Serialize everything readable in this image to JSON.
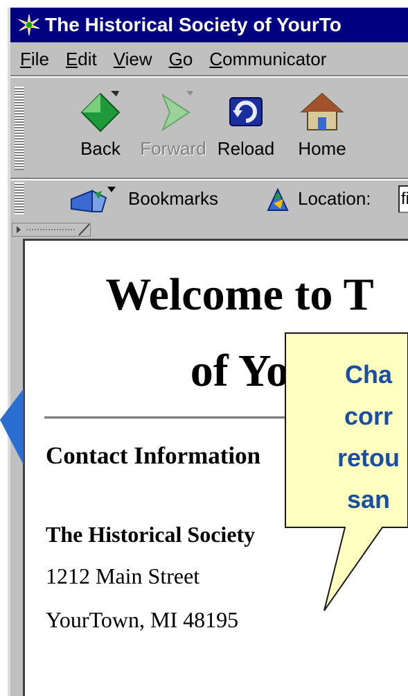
{
  "window": {
    "title": "The Historical Society of YourTo",
    "menu": [
      "File",
      "Edit",
      "View",
      "Go",
      "Communicator"
    ],
    "menu_mnemonics": [
      "F",
      "E",
      "V",
      "G",
      "C"
    ]
  },
  "navigation": {
    "back_label": "Back",
    "forward_label": "Forward",
    "reload_label": "Reload",
    "home_label": "Home"
  },
  "location_bar": {
    "bookmarks_label": "Bookmarks",
    "location_label": "Location:",
    "url_value": "file"
  },
  "page": {
    "heading_line1": "Welcome to T",
    "heading_line2": "of Yo",
    "contact_heading": "Contact Information",
    "org_name": "The Historical Society",
    "address_line1": "1212 Main Street",
    "address_line2": "YourTown, MI 48195"
  },
  "callout": {
    "lines": [
      "Cha",
      "corr",
      "retou",
      "san"
    ],
    "fill_color": "#ffffc0",
    "text_color": "#1a4ea2"
  },
  "colors": {
    "titlebar": "#000080",
    "chrome": "#c0c0c0",
    "arrow_accent": "#2a6fd0"
  }
}
